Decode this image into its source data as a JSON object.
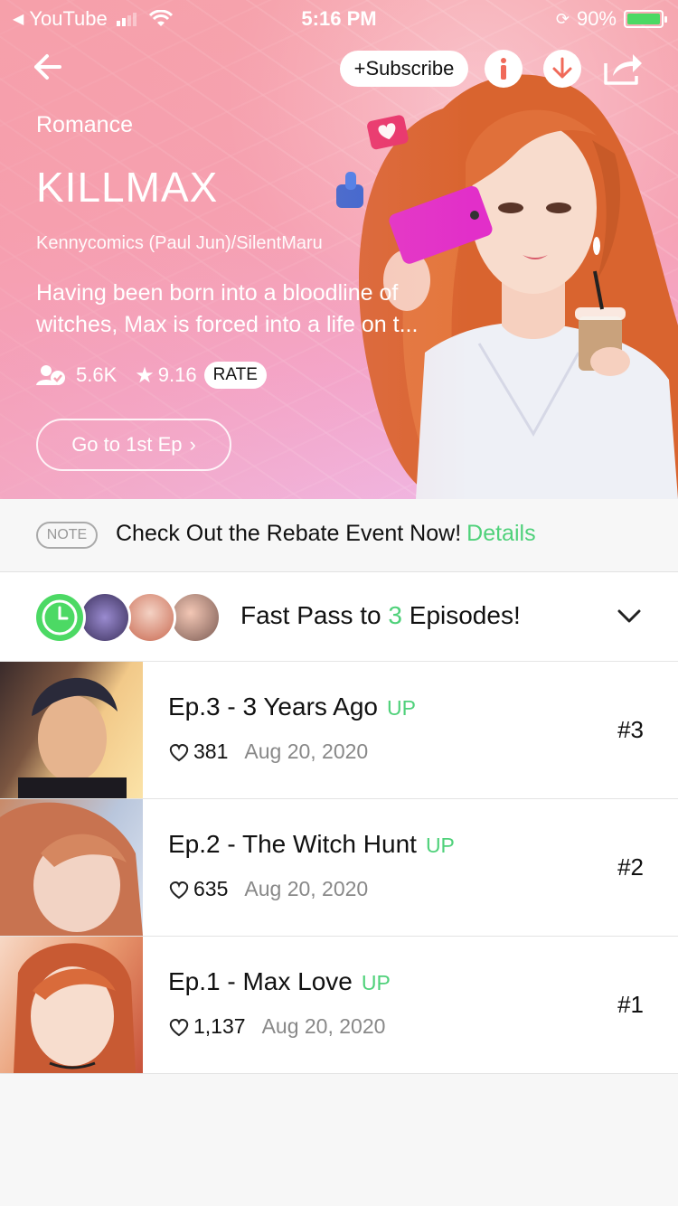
{
  "status": {
    "back_app": "YouTube",
    "time": "5:16 PM",
    "battery": "90%"
  },
  "header": {
    "subscribe_label": "+Subscribe"
  },
  "comic": {
    "genre": "Romance",
    "title": "KILLMAX",
    "author": "Kennycomics (Paul Jun)/SilentMaru",
    "description": "Having been born into a bloodline of witches, Max is forced into a life on t...",
    "subscribers": "5.6K",
    "rating": "9.16",
    "rate_label": "RATE",
    "first_ep_label": "Go to 1st Ep"
  },
  "note": {
    "tag": "NOTE",
    "message": "Check Out the Rebate Event Now!",
    "link": "Details"
  },
  "fastpass": {
    "prefix": "Fast Pass to ",
    "count": "3",
    "suffix": " Episodes!"
  },
  "episodes": [
    {
      "title": "Ep.3 - 3 Years Ago",
      "badge": "UP",
      "likes": "381",
      "date": "Aug 20, 2020",
      "number": "#3"
    },
    {
      "title": "Ep.2 - The Witch Hunt",
      "badge": "UP",
      "likes": "635",
      "date": "Aug 20, 2020",
      "number": "#2"
    },
    {
      "title": "Ep.1 - Max Love",
      "badge": "UP",
      "likes": "1,137",
      "date": "Aug 20, 2020",
      "number": "#1"
    }
  ],
  "colors": {
    "accent": "#4fd17a",
    "hero_pink": "#f6a4ad",
    "battery": "#4cd964"
  }
}
